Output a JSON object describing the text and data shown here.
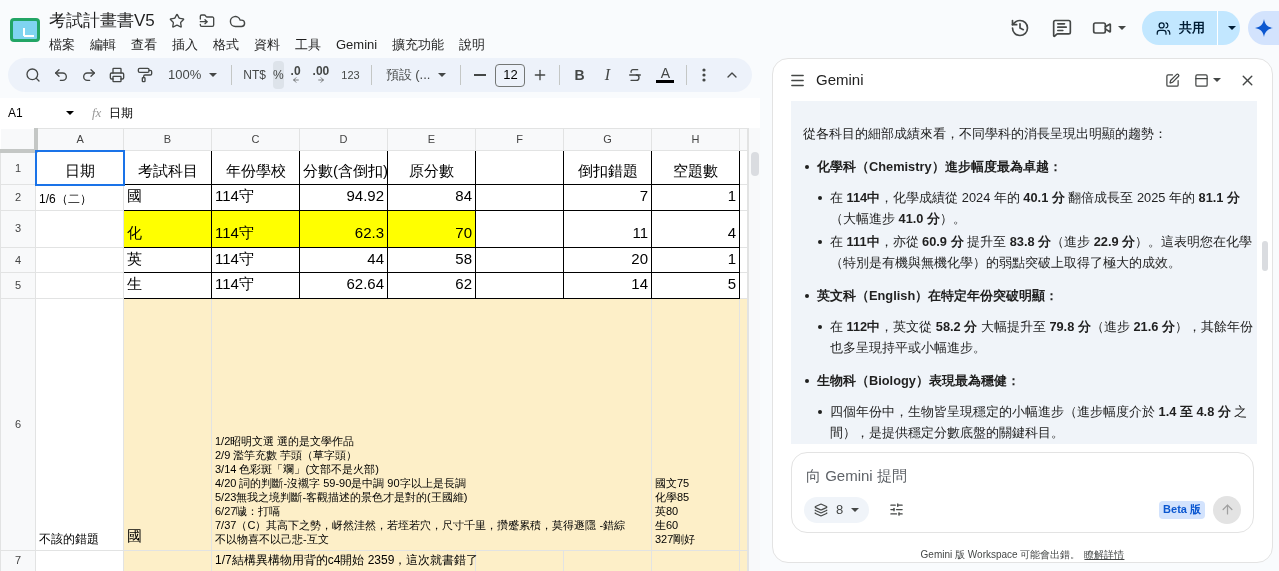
{
  "document": {
    "title": "考試計畫書V5"
  },
  "menu": [
    "檔案",
    "編輯",
    "查看",
    "插入",
    "格式",
    "資料",
    "工具",
    "Gemini",
    "擴充功能",
    "說明"
  ],
  "toolbar": {
    "zoom": "100%",
    "currency": "NT$",
    "percent": {
      "label": "%",
      "active": true
    },
    "decrease_decimal": ".0",
    "increase_decimal": ".00",
    "number_format": "123",
    "font": "預設 (...",
    "font_size": "12",
    "bold": "B",
    "italic": "I",
    "text_color": "A"
  },
  "formula_bar": {
    "cell_ref": "A1",
    "fx": "fx",
    "value": "日期"
  },
  "sheet": {
    "columns": [
      "A",
      "B",
      "C",
      "D",
      "E",
      "F",
      "G",
      "H"
    ],
    "rows": [
      {
        "number": "1",
        "cells": [
          {
            "kind": "heading",
            "text": "日期",
            "selected": true
          },
          {
            "kind": "heading",
            "text": "考試科目",
            "selected": false
          },
          {
            "kind": "heading",
            "text": "年份學校",
            "selected": false
          },
          {
            "kind": "heading",
            "text": "分數(含倒扣)",
            "selected": false
          },
          {
            "kind": "heading",
            "text": "原分數",
            "selected": false
          },
          {
            "kind": "empty",
            "selected": false
          },
          {
            "kind": "heading",
            "text": "倒扣錯題",
            "selected": false
          },
          {
            "kind": "heading",
            "text": "空題數",
            "selected": false
          }
        ]
      },
      {
        "number": "2",
        "cells": [
          {
            "kind": "note",
            "text": "1/6（二）",
            "selected": false
          },
          {
            "kind": "text",
            "text": "國",
            "selected": false
          },
          {
            "kind": "text",
            "text": "114守",
            "selected": false
          },
          {
            "kind": "number",
            "text": "94.92",
            "selected": false
          },
          {
            "kind": "number",
            "text": "84",
            "selected": false
          },
          {
            "kind": "empty",
            "selected": false
          },
          {
            "kind": "number",
            "text": "7",
            "selected": false
          },
          {
            "kind": "number",
            "text": "1",
            "selected": false
          }
        ]
      },
      {
        "number": "3",
        "cells": [
          {
            "kind": "empty",
            "selected": false
          },
          {
            "kind": "text",
            "text": "化",
            "selected": false,
            "color": "#ffff00"
          },
          {
            "kind": "text",
            "text": "114守",
            "selected": false,
            "color": "#ffff00"
          },
          {
            "kind": "number",
            "text": "62.3",
            "selected": false,
            "color": "#ffff00"
          },
          {
            "kind": "number",
            "text": "70",
            "selected": false,
            "color": "#ffff00"
          },
          {
            "kind": "empty",
            "selected": false
          },
          {
            "kind": "number",
            "text": "11",
            "selected": false
          },
          {
            "kind": "number",
            "text": "4",
            "selected": false
          }
        ]
      },
      {
        "number": "4",
        "cells": [
          {
            "kind": "empty",
            "selected": false
          },
          {
            "kind": "text",
            "text": "英",
            "selected": false
          },
          {
            "kind": "text",
            "text": "114守",
            "selected": false
          },
          {
            "kind": "number",
            "text": "44",
            "selected": false
          },
          {
            "kind": "number",
            "text": "58",
            "selected": false
          },
          {
            "kind": "empty",
            "selected": false
          },
          {
            "kind": "number",
            "text": "20",
            "selected": false
          },
          {
            "kind": "number",
            "text": "1",
            "selected": false
          }
        ]
      },
      {
        "number": "5",
        "cells": [
          {
            "kind": "empty",
            "selected": false
          },
          {
            "kind": "text",
            "text": "生",
            "selected": false
          },
          {
            "kind": "text",
            "text": "114守",
            "selected": false
          },
          {
            "kind": "number",
            "text": "62.64",
            "selected": false
          },
          {
            "kind": "number",
            "text": "62",
            "selected": false
          },
          {
            "kind": "empty",
            "selected": false
          },
          {
            "kind": "number",
            "text": "14",
            "selected": false
          },
          {
            "kind": "number",
            "text": "5",
            "selected": false
          }
        ]
      },
      {
        "number": "6",
        "cells": [
          {
            "kind": "note",
            "text": "不該的錯題",
            "selected": false
          },
          {
            "kind": "text",
            "text": "國",
            "selected": false,
            "color": "#fdefc8"
          },
          {
            "kind": "lines",
            "lines": [
              "1/2昭明文選 選的是文學作品",
              "2/9 濫竽充數 芋頭（草字頭）",
              "3/14 色彩斑「斕」(文部不是火部)",
              "4/20 詞的判斷-沒襯字 59-90是中調 90字以上是長調",
              "5/23無我之境判斷-客觀描述的景色才是對的(王國維)",
              "6/27噦：打嗝",
              "7/37（C）其高下之勢，岈然洼然，若垤若穴，尺寸千里，攢蹙累積，莫得遯隱  -錯綜",
              "不以物喜不以己悲-互文"
            ],
            "colspan": 5,
            "selected": false,
            "color": "#fdefc8"
          },
          {
            "kind": "lines",
            "lines": [
              "國文75",
              "化學85",
              "英80",
              "生60",
              "327剛好"
            ],
            "selected": false,
            "color": "#fdefc8"
          }
        ]
      },
      {
        "number": "7",
        "cells": [
          {
            "kind": "empty",
            "selected": false
          },
          {
            "kind": "empty",
            "selected": false,
            "color": "#fdefc8"
          },
          {
            "kind": "note",
            "text": "1/7結構異構物用背的c4開始 2359，這次就書錯了",
            "colspan": 3,
            "selected": false,
            "color": "#fdefc8"
          },
          {
            "kind": "empty",
            "selected": false,
            "color": "#fdefc8"
          },
          {
            "kind": "empty",
            "selected": false,
            "color": "#fdefc8"
          },
          {
            "kind": "empty",
            "selected": false,
            "color": "#fdefc8"
          }
        ]
      }
    ]
  },
  "share_button": "共用",
  "gemini": {
    "title": "Gemini",
    "intro": "從各科目的細部成績來看，不同學科的消長呈現出明顯的趨勢：",
    "points": [
      {
        "heading": "化學科（Chemistry）進步幅度最為卓越：",
        "children": [
          "在 **114中**，化學成績從 2024 年的 **40.1 分** 翻倍成長至 2025 年的 **81.1 分**（大幅進步 **41.0 分**）。",
          "在 **111中**，亦從 **60.9 分** 提升至 **83.8 分**（進步 **22.9 分**）。這表明您在化學（特別是有機與無機化學）的弱點突破上取得了極大的成效。"
        ]
      },
      {
        "heading": "英文科（English）在特定年份突破明顯：",
        "children": [
          "在 **112中**，英文從 **58.2 分** 大幅提升至 **79.8 分**（進步 **21.6 分**），其餘年份也多呈現持平或小幅進步。"
        ]
      },
      {
        "heading": "生物科（Biology）表現最為穩健：",
        "children": [
          "四個年份中，生物皆呈現穩定的小幅進步（進步幅度介於 **1.4 至 4.8 分** 之間），是提供穩定分數底盤的關鍵科目。"
        ]
      }
    ],
    "prompt": {
      "placeholder": "向 Gemini 提問"
    },
    "source_count": "8",
    "badge": "Beta 版",
    "disclaimer": "Gemini 版 Workspace 可能會出錯。",
    "link": "瞭解詳情"
  }
}
